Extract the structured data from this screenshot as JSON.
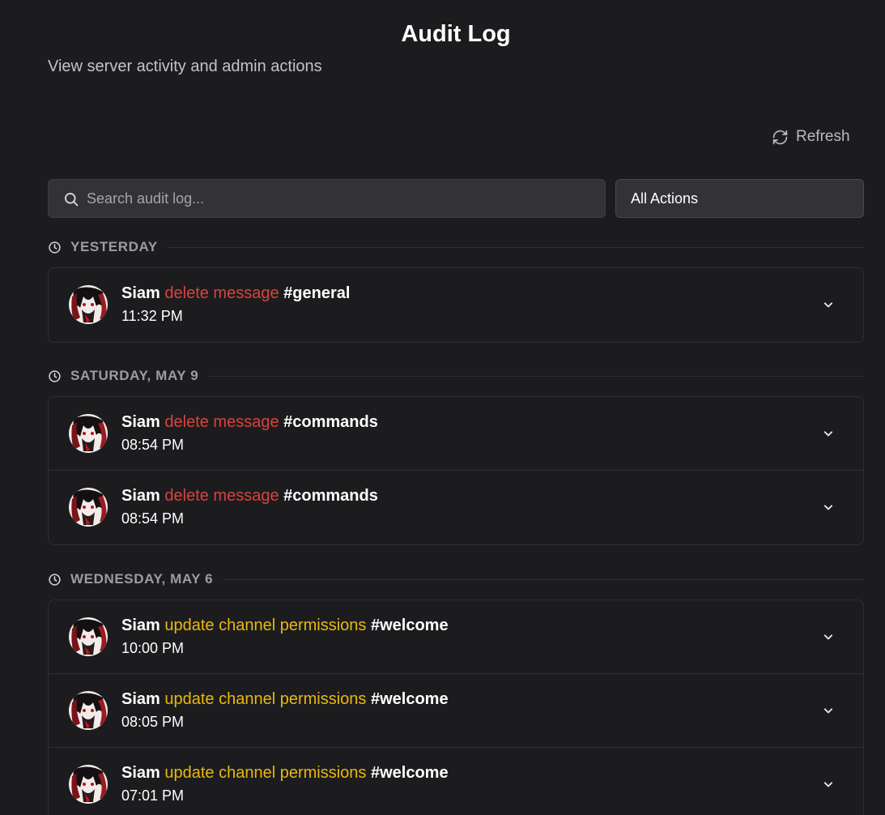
{
  "header": {
    "title": "Audit Log",
    "subtitle": "View server activity and admin actions",
    "refresh_label": "Refresh"
  },
  "filters": {
    "search_placeholder": "Search audit log...",
    "action_filter": "All Actions"
  },
  "colors": {
    "delete_action": "#d8433e",
    "update_action": "#eab80f",
    "background": "#1c1c1f"
  },
  "groups": [
    {
      "label": "YESTERDAY",
      "entries": [
        {
          "user": "Siam",
          "action": "delete message",
          "channel": "#general",
          "time": "11:32 PM"
        }
      ]
    },
    {
      "label": "SATURDAY, MAY 9",
      "entries": [
        {
          "user": "Siam",
          "action": "delete message",
          "channel": "#commands",
          "time": "08:54 PM"
        },
        {
          "user": "Siam",
          "action": "delete message",
          "channel": "#commands",
          "time": "08:54 PM"
        }
      ]
    },
    {
      "label": "WEDNESDAY, MAY 6",
      "entries": [
        {
          "user": "Siam",
          "action": "update channel permissions",
          "channel": "#welcome",
          "time": "10:00 PM"
        },
        {
          "user": "Siam",
          "action": "update channel permissions",
          "channel": "#welcome",
          "time": "08:05 PM"
        },
        {
          "user": "Siam",
          "action": "update channel permissions",
          "channel": "#welcome",
          "time": "07:01 PM"
        }
      ]
    }
  ]
}
